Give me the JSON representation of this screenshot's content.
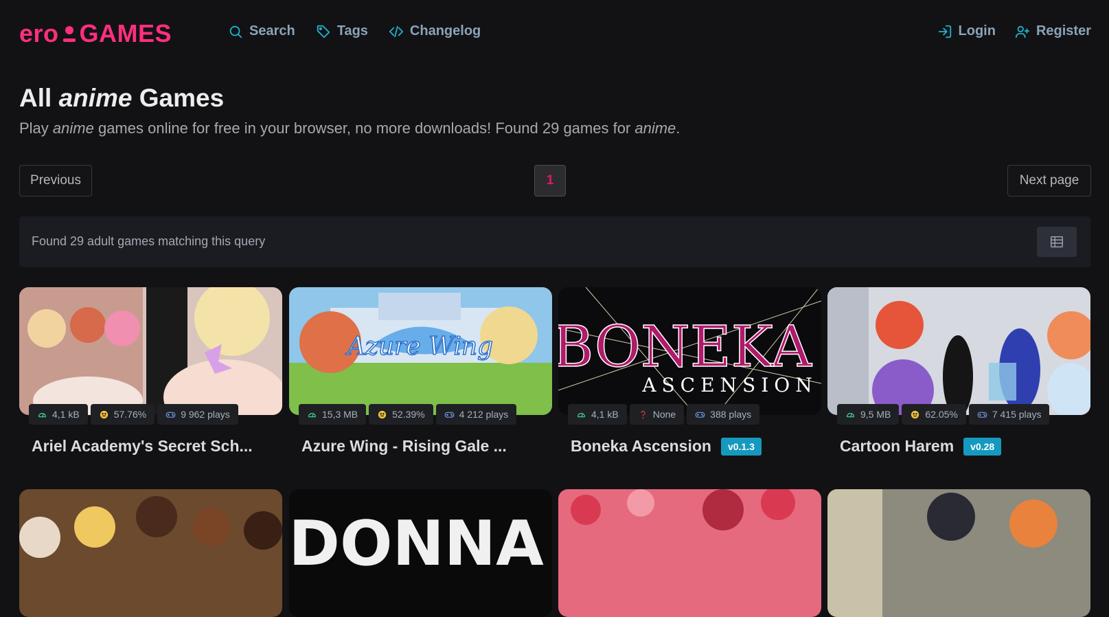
{
  "brand": {
    "left": "ero",
    "right": "GAMES",
    "color": "#ff2f7e"
  },
  "nav": {
    "links": [
      {
        "label": "Search",
        "icon": "search-icon"
      },
      {
        "label": "Tags",
        "icon": "tag-icon"
      },
      {
        "label": "Changelog",
        "icon": "code-icon"
      }
    ],
    "login": "Login",
    "register": "Register"
  },
  "heading": {
    "title_prefix": "All ",
    "title_tag": "anime",
    "title_suffix": " Games",
    "sub_prefix": "Play ",
    "sub_tag": "anime",
    "sub_middle": " games online for free in your browser, no more downloads! Found 29 games for ",
    "sub_tag2": "anime",
    "sub_end": "."
  },
  "pagination": {
    "previous": "Previous",
    "current": "1",
    "next": "Next page"
  },
  "results": {
    "text": "Found 29 adult games matching this query"
  },
  "colors": {
    "accent": "#1fb3cf",
    "page_active": "#e5195e",
    "version_badge": "#1699bf"
  },
  "games": [
    {
      "title": "Ariel Academy's Secret Sch...",
      "size": "4,1 kB",
      "rating": "57.76%",
      "rating_icon": "smile",
      "plays": "9 962 plays",
      "version": ""
    },
    {
      "title": "Azure Wing - Rising Gale ...",
      "size": "15,3 MB",
      "rating": "52.39%",
      "rating_icon": "smile",
      "plays": "4 212 plays",
      "version": ""
    },
    {
      "title": "Boneka Ascension",
      "size": "4,1 kB",
      "rating": "None",
      "rating_icon": "question",
      "plays": "388 plays",
      "version": "v0.1.3"
    },
    {
      "title": "Cartoon Harem",
      "size": "9,5 MB",
      "rating": "62.05%",
      "rating_icon": "smile",
      "plays": "7 415 plays",
      "version": "v0.28"
    }
  ]
}
